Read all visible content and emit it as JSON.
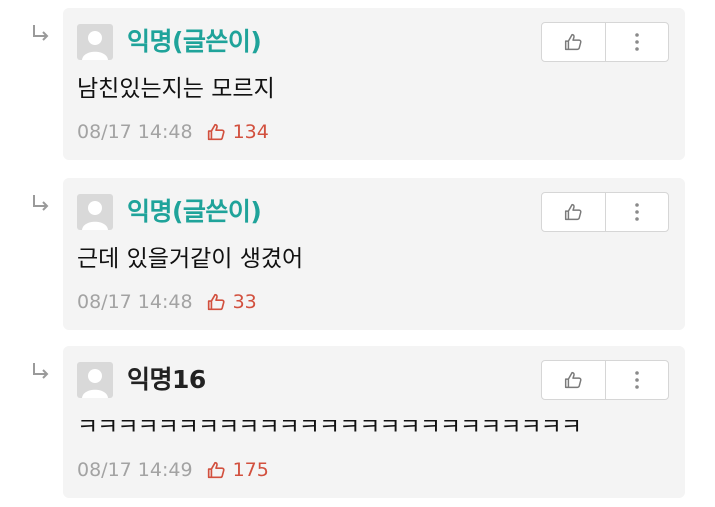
{
  "comments": [
    {
      "author": "익명(글쓴이)",
      "is_op": true,
      "text": "남친있는지는 모르지",
      "time": "08/17 14:48",
      "likes": "134"
    },
    {
      "author": "익명(글쓴이)",
      "is_op": true,
      "text": "근데 있을거같이 생겼어",
      "time": "08/17 14:48",
      "likes": "33"
    },
    {
      "author": "익명16",
      "is_op": false,
      "text": "ㅋㅋㅋㅋㅋㅋㅋㅋㅋㅋㅋㅋㅋㅋㅋㅋㅋㅋㅋㅋㅋㅋㅋㅋㅋ",
      "time": "08/17 14:49",
      "likes": "175"
    }
  ],
  "colors": {
    "op_author": "#1fa39a",
    "like_count": "#d2503e",
    "meta_text": "#a3a3a3",
    "card_bg": "#f4f4f4"
  },
  "icons": {
    "reply": "reply-arrow-icon",
    "avatar": "default-avatar-icon",
    "vote": "thumbs-up-icon",
    "menu": "more-vertical-icon"
  }
}
